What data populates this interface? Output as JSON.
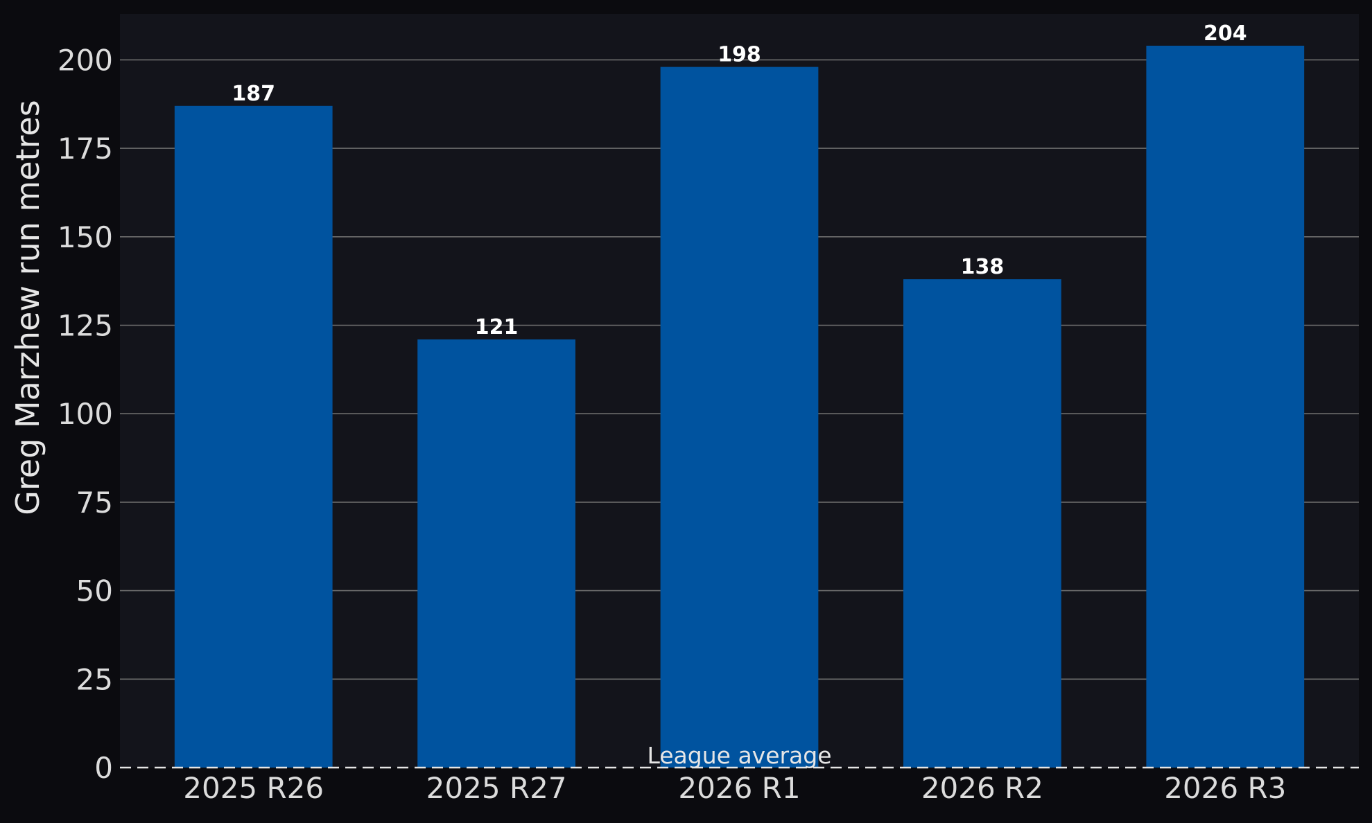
{
  "chart_data": {
    "type": "bar",
    "categories": [
      "2025 R26",
      "2025 R27",
      "2026 R1",
      "2026 R2",
      "2026 R3"
    ],
    "values": [
      187,
      121,
      198,
      138,
      204
    ],
    "value_labels": [
      "187",
      "121",
      "198",
      "138",
      "204"
    ],
    "ylabel": "Greg Marzhew run metres",
    "xlabel": "",
    "ylim": [
      0,
      213
    ],
    "yticks": [
      0,
      25,
      50,
      75,
      100,
      125,
      150,
      175,
      200
    ],
    "grid": "horizontal",
    "reference_line": {
      "value": 0,
      "label": "League average",
      "style": "dashed"
    },
    "colors": {
      "background": "#0b0b0f",
      "plot_background": "#13141b",
      "bar": "#00539f",
      "grid": "#6e6e6e",
      "reference_line": "#e6e6e6",
      "text": "#dcdcdc"
    }
  }
}
